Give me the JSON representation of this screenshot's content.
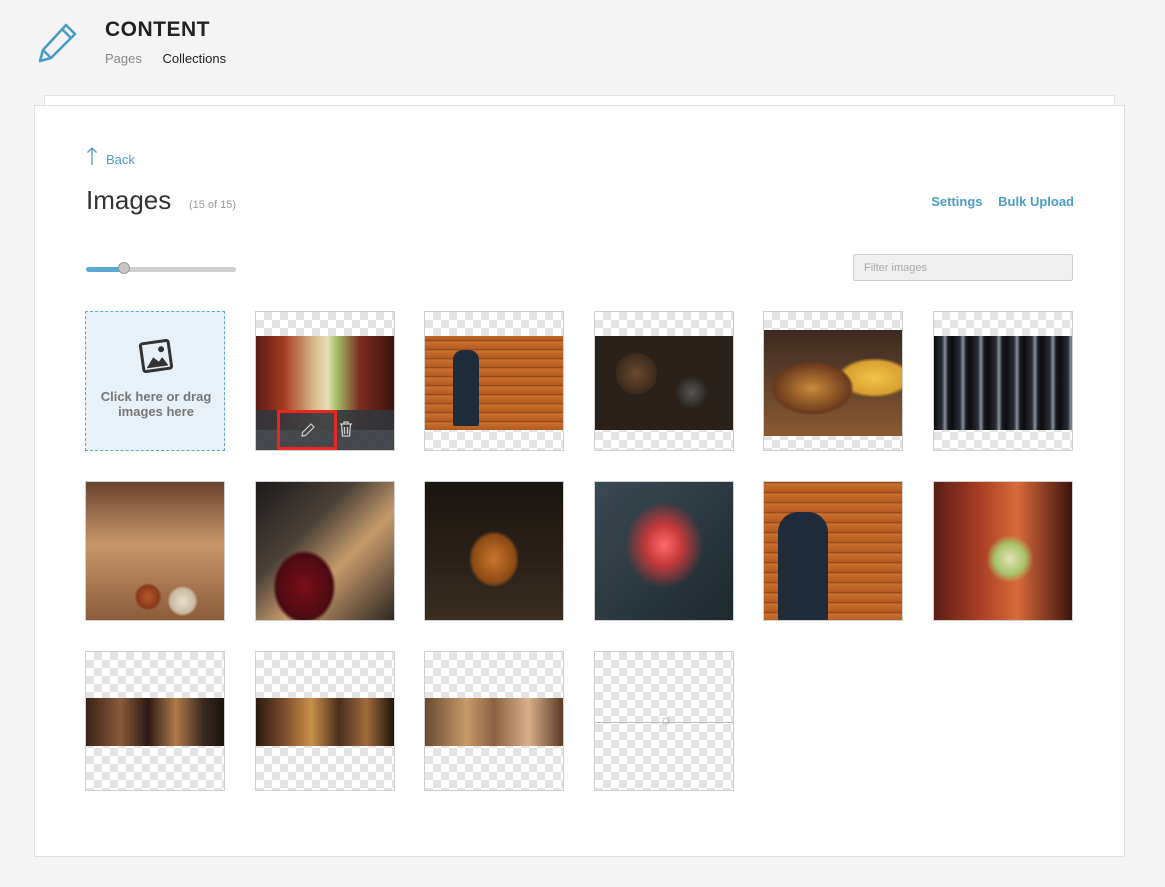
{
  "header": {
    "title": "CONTENT",
    "nav": [
      "Pages",
      "Collections"
    ],
    "active_nav": "Collections"
  },
  "panel": {
    "back_label": "Back",
    "title": "Images",
    "count": "(15 of 15)",
    "actions": [
      "Settings",
      "Bulk Upload"
    ],
    "size_slider_fraction": 0.25,
    "filter_placeholder": "Filter images",
    "upload_text": "Click here or drag images here"
  },
  "colors": {
    "accent": "#4a9dc6",
    "highlight": "#e8281f",
    "upload_bg": "#e8f1f8"
  },
  "images": [
    {
      "subject": "mojito cocktail",
      "shape": "landscape",
      "hovered": true,
      "icon_edit": "pencil-icon",
      "icon_delete": "trash-icon"
    },
    {
      "subject": "banjo player on wooden wall",
      "shape": "landscape"
    },
    {
      "subject": "mortar and pestle on dark table",
      "shape": "landscape"
    },
    {
      "subject": "burger and fries",
      "shape": "landscape"
    },
    {
      "subject": "stacked glasses",
      "shape": "landscape"
    },
    {
      "subject": "cups on table",
      "shape": "square"
    },
    {
      "subject": "red wine pouring",
      "shape": "square"
    },
    {
      "subject": "pint of beer",
      "shape": "square"
    },
    {
      "subject": "thank you neon sign",
      "shape": "square"
    },
    {
      "subject": "banjo player on wooden wall",
      "shape": "square"
    },
    {
      "subject": "mojito cocktail",
      "shape": "square"
    },
    {
      "subject": "crowded bar",
      "shape": "wide"
    },
    {
      "subject": "restaurant interior",
      "shape": "wide"
    },
    {
      "subject": "bar counter",
      "shape": "wide"
    },
    {
      "subject": "empty placeholder",
      "shape": "transparent"
    }
  ]
}
